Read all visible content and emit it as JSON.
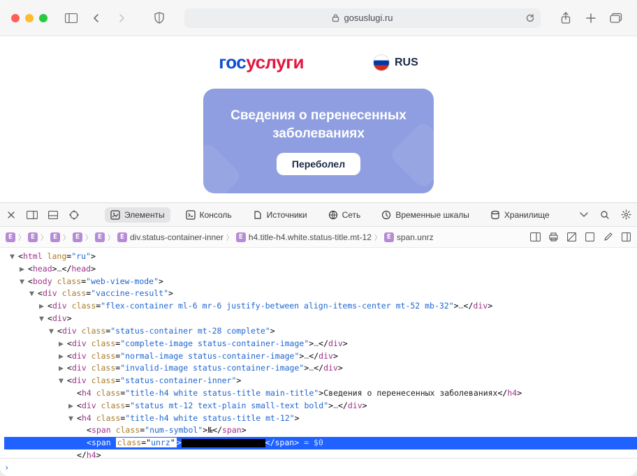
{
  "addr": {
    "domain": "gosuslugi.ru"
  },
  "brand": {
    "gos": "гос",
    "usl": "услуги",
    "lang": "RUS"
  },
  "card": {
    "title_line1": "Сведения о перенесенных",
    "title_line2": "заболеваниях",
    "button": "Переболел"
  },
  "devtools": {
    "tabs": {
      "elements": "Элементы",
      "console": "Консоль",
      "sources": "Источники",
      "network": "Сеть",
      "timelines": "Временные шкалы",
      "storage": "Хранилище"
    },
    "breadcrumbs": [
      "div.status-container-inner",
      "h4.title-h4.white.status-title.mt-12",
      "span.unrz"
    ],
    "dom": {
      "html_open": "<html lang=\"ru\">",
      "head": "<head>…</head>",
      "body_open": "<body class=\"web-view-mode\">",
      "vaccine_result_open": "<div class=\"vaccine-result\">",
      "flex_container": "<div class=\"flex-container ml-6 mr-6 justify-between align-items-center mt-52 mb-32\">…</div>",
      "div_open": "<div>",
      "status_container_open": "<div class=\"status-container mt-28 complete\">",
      "complete_image": "<div class=\"complete-image status-container-image\">…</div>",
      "normal_image": "<div class=\"normal-image status-container-image\">…</div>",
      "invalid_image": "<div class=\"invalid-image status-container-image\">…</div>",
      "inner_open": "<div class=\"status-container-inner\">",
      "h4_main": "<h4 class=\"title-h4 white status-title main-title\">Сведения о перенесенных заболеваниях</h4>",
      "status_div": "<div class=\"status mt-12 text-plain small-text bold\">…</div>",
      "h4_mt12_open": "<h4 class=\"title-h4 white status-title mt-12\">",
      "span_num": "<span class=\"num-symbol\">№</span>",
      "span_unrz_open": "<span class=\"unrz\">",
      "span_close": "</span>",
      "eqvar": " = $0",
      "h4_close": "</h4>",
      "div_close": "</div>"
    },
    "console_prompt": "›"
  }
}
